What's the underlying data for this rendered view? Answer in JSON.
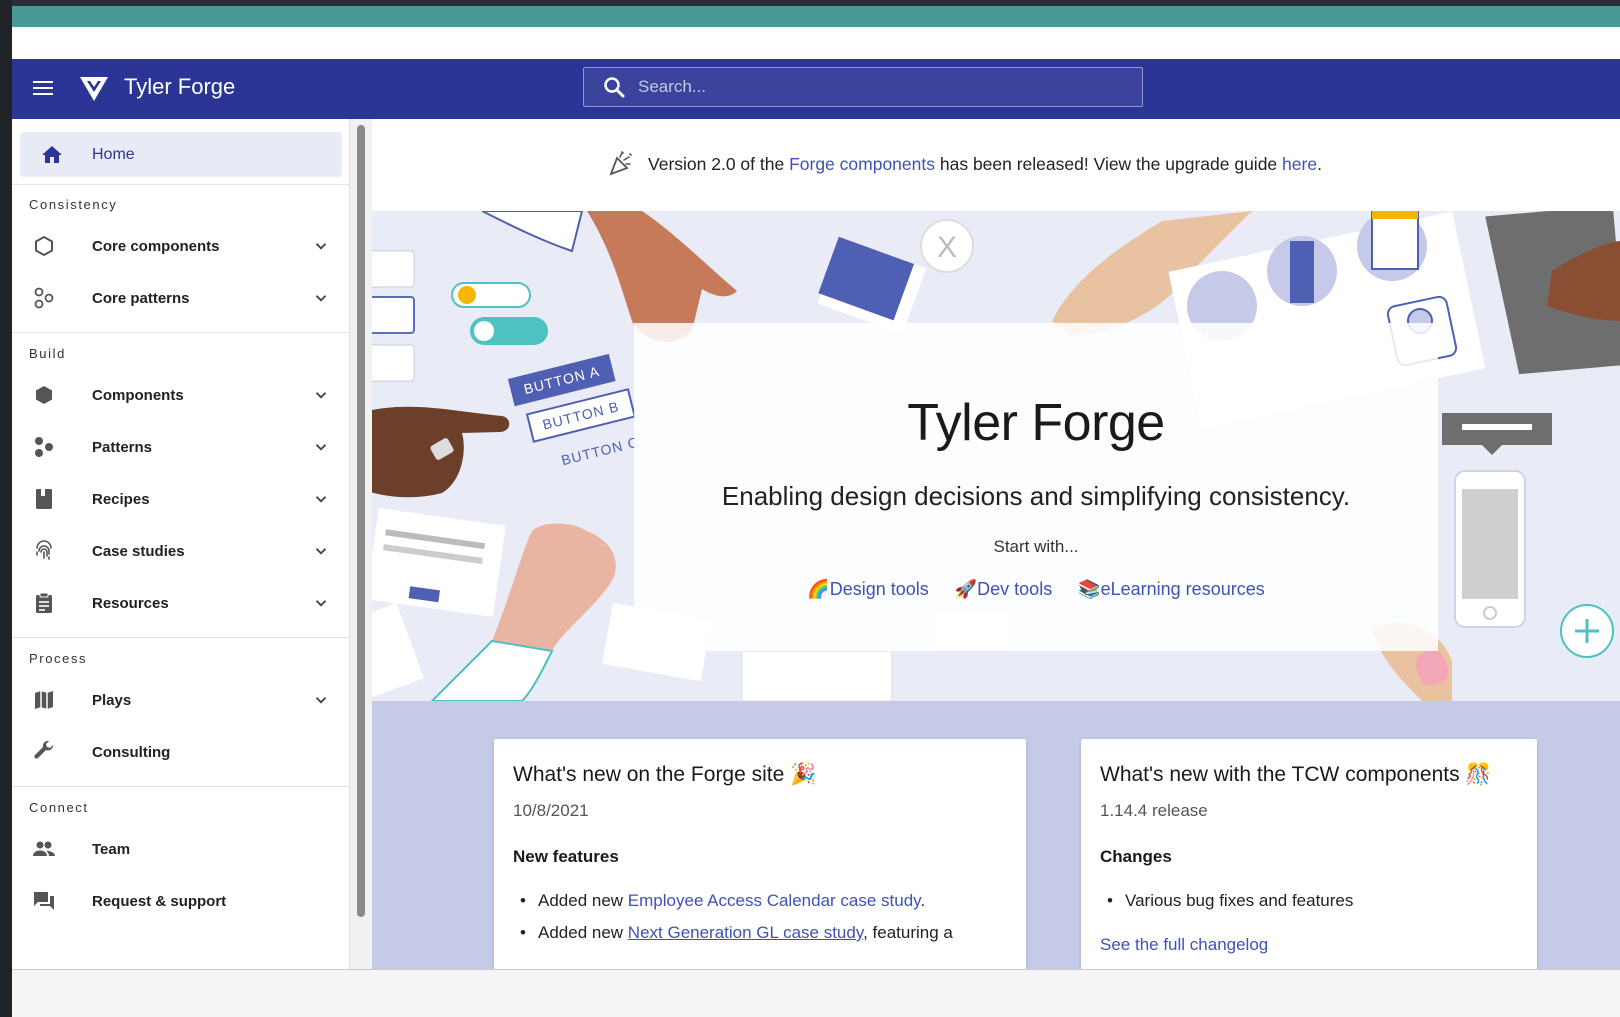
{
  "header": {
    "title": "Tyler Forge",
    "search_placeholder": "Search..."
  },
  "sidebar": {
    "home": "Home",
    "sections": [
      {
        "title": "Consistency",
        "items": [
          {
            "label": "Core components",
            "icon": "hexagon-outline-icon",
            "expandable": true
          },
          {
            "label": "Core patterns",
            "icon": "shapes-outline-icon",
            "expandable": true
          }
        ]
      },
      {
        "title": "Build",
        "items": [
          {
            "label": "Components",
            "icon": "hexagon-icon",
            "expandable": true
          },
          {
            "label": "Patterns",
            "icon": "shapes-icon",
            "expandable": true
          },
          {
            "label": "Recipes",
            "icon": "book-icon",
            "expandable": true
          },
          {
            "label": "Case studies",
            "icon": "fingerprint-icon",
            "expandable": true
          },
          {
            "label": "Resources",
            "icon": "clipboard-icon",
            "expandable": true
          }
        ]
      },
      {
        "title": "Process",
        "items": [
          {
            "label": "Plays",
            "icon": "map-icon",
            "expandable": true
          },
          {
            "label": "Consulting",
            "icon": "wrench-icon",
            "expandable": false
          }
        ]
      },
      {
        "title": "Connect",
        "items": [
          {
            "label": "Team",
            "icon": "people-icon",
            "expandable": false
          },
          {
            "label": "Request & support",
            "icon": "forum-icon",
            "expandable": false
          }
        ]
      }
    ]
  },
  "banner": {
    "prefix": "Version 2.0 of the ",
    "link1": "Forge components",
    "middle": " has been released! View the upgrade guide ",
    "link2": "here",
    "suffix": "."
  },
  "hero": {
    "title": "Tyler Forge",
    "tagline": "Enabling design decisions and simplifying consistency.",
    "start": "Start with...",
    "links": [
      "🌈Design tools",
      "🚀Dev tools",
      "📚eLearning resources"
    ],
    "illustration_labels": [
      "BUTTON A",
      "BUTTON B",
      "BUTTON C",
      "X"
    ]
  },
  "cards": {
    "site": {
      "title": "What's new on the Forge site 🎉",
      "date": "10/8/2021",
      "heading": "New features",
      "items": [
        {
          "prefix": "Added new ",
          "link": "Employee Access Calendar case study",
          "suffix": "."
        },
        {
          "prefix": "Added new ",
          "link": "Next Generation GL case study",
          "suffix": ", featuring a"
        }
      ]
    },
    "tcw": {
      "title": "What's new with the TCW components 🎊",
      "release": "1.14.4 release",
      "heading": "Changes",
      "items": [
        "Various bug fixes and features"
      ],
      "cut_link": "See the full changelog"
    }
  },
  "colors": {
    "header": "#2b3595",
    "accent": "#3f51b5",
    "teal": "#4a9996",
    "lower_bg": "#c5cae9"
  }
}
